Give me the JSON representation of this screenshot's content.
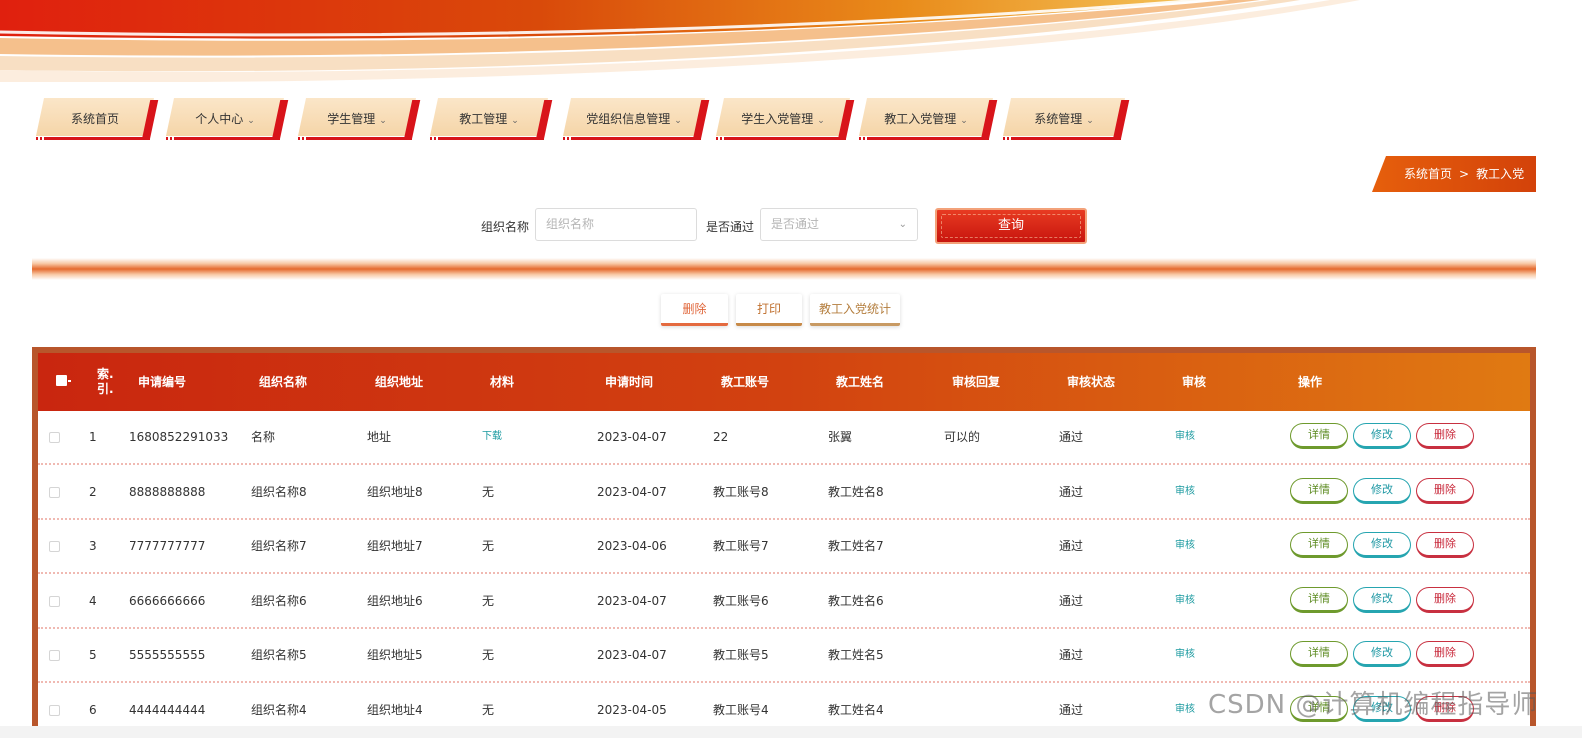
{
  "nav": {
    "items": [
      {
        "label": "系统首页",
        "has_dropdown": false
      },
      {
        "label": "个人中心",
        "has_dropdown": true
      },
      {
        "label": "学生管理",
        "has_dropdown": true
      },
      {
        "label": "教工管理",
        "has_dropdown": true
      },
      {
        "label": "党组织信息管理",
        "has_dropdown": true
      },
      {
        "label": "学生入党管理",
        "has_dropdown": true
      },
      {
        "label": "教工入党管理",
        "has_dropdown": true
      },
      {
        "label": "系统管理",
        "has_dropdown": true
      }
    ],
    "chevron": "⌄"
  },
  "breadcrumb": {
    "home": "系统首页",
    "separator": ">",
    "current": "教工入党"
  },
  "search": {
    "org_name_label": "组织名称",
    "org_name_placeholder": "组织名称",
    "passed_label": "是否通过",
    "passed_placeholder": "是否通过",
    "query_button": "查询"
  },
  "actions": {
    "delete": "删除",
    "print": "打印",
    "stats": "教工入党统计"
  },
  "table": {
    "headers": {
      "index": "索引.",
      "index_line1": "索.",
      "index_line2": "引.",
      "app_no": "申请编号",
      "org_name": "组织名称",
      "org_addr": "组织地址",
      "material": "材料",
      "app_time": "申请时间",
      "staff_account": "教工账号",
      "staff_name": "教工姓名",
      "review_reply": "审核回复",
      "review_status": "审核状态",
      "review": "审核",
      "ops": "操作"
    },
    "op_labels": {
      "detail": "详情",
      "edit": "修改",
      "delete": "删除"
    },
    "review_link": "审核",
    "rows": [
      {
        "idx": "1",
        "app_no": "1680852291033",
        "org_name": "名称",
        "org_addr": "地址",
        "material": "下载",
        "material_link": true,
        "app_time": "2023-04-07",
        "staff_account": "22",
        "staff_name": "张翼",
        "review_reply": "可以的",
        "review_status": "通过"
      },
      {
        "idx": "2",
        "app_no": "8888888888",
        "org_name": "组织名称8",
        "org_addr": "组织地址8",
        "material": "无",
        "material_link": false,
        "app_time": "2023-04-07",
        "staff_account": "教工账号8",
        "staff_name": "教工姓名8",
        "review_reply": "",
        "review_status": "通过"
      },
      {
        "idx": "3",
        "app_no": "7777777777",
        "org_name": "组织名称7",
        "org_addr": "组织地址7",
        "material": "无",
        "material_link": false,
        "app_time": "2023-04-06",
        "staff_account": "教工账号7",
        "staff_name": "教工姓名7",
        "review_reply": "",
        "review_status": "通过"
      },
      {
        "idx": "4",
        "app_no": "6666666666",
        "org_name": "组织名称6",
        "org_addr": "组织地址6",
        "material": "无",
        "material_link": false,
        "app_time": "2023-04-07",
        "staff_account": "教工账号6",
        "staff_name": "教工姓名6",
        "review_reply": "",
        "review_status": "通过"
      },
      {
        "idx": "5",
        "app_no": "5555555555",
        "org_name": "组织名称5",
        "org_addr": "组织地址5",
        "material": "无",
        "material_link": false,
        "app_time": "2023-04-07",
        "staff_account": "教工账号5",
        "staff_name": "教工姓名5",
        "review_reply": "",
        "review_status": "通过"
      },
      {
        "idx": "6",
        "app_no": "4444444444",
        "org_name": "组织名称4",
        "org_addr": "组织地址4",
        "material": "无",
        "material_link": false,
        "app_time": "2023-04-05",
        "staff_account": "教工账号4",
        "staff_name": "教工姓名4",
        "review_reply": "",
        "review_status": "通过"
      }
    ]
  },
  "watermark": "CSDN @计算机编程指导师",
  "colors": {
    "primary_red": "#d8141a",
    "header_start": "#c9260f",
    "header_end": "#e07a12",
    "link_teal": "#1b9aa0"
  }
}
